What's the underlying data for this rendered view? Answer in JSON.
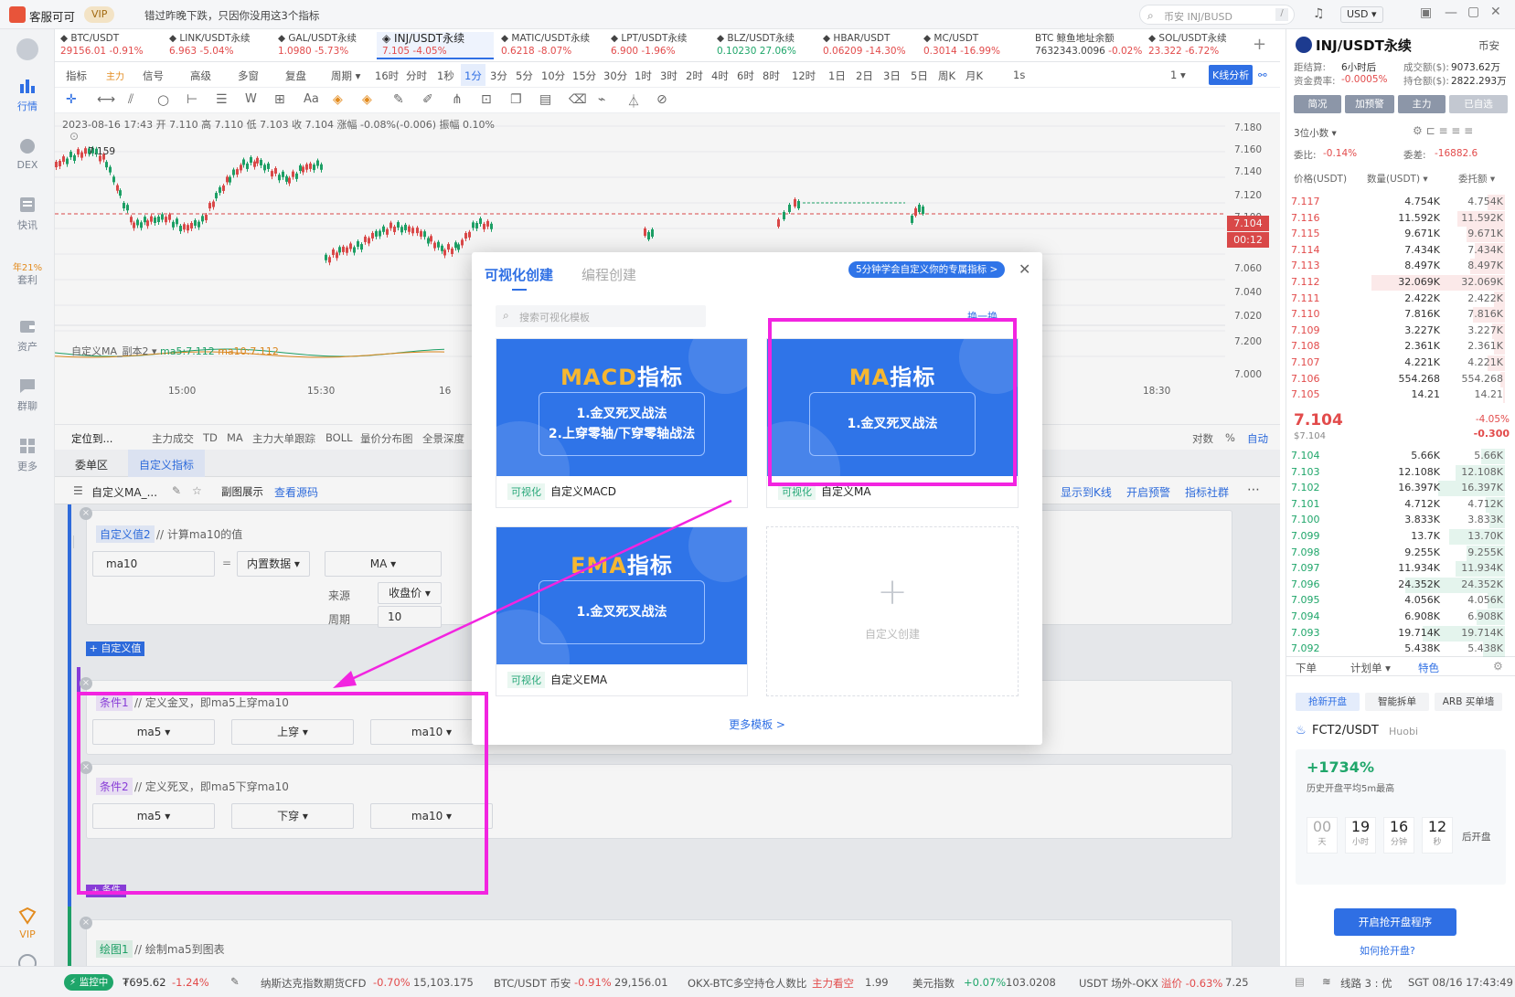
{
  "topbar": {
    "customer_service": "客服可可",
    "vip": "VIP",
    "notice": "错过昨晚下跌，只因你没用这3个指标",
    "search_placeholder": "币安 INJ/BUSD",
    "shortcut": "/",
    "currency": "USD ▾"
  },
  "left_nav": [
    {
      "label": "行情",
      "icon": "market-chart-icon"
    },
    {
      "label": "DEX",
      "icon": "dex-icon"
    },
    {
      "label": "快讯",
      "icon": "news-icon"
    },
    {
      "label": "年21%",
      "icon": ""
    },
    {
      "label": "套利",
      "icon": ""
    },
    {
      "label": "资产",
      "icon": "wallet-icon"
    },
    {
      "label": "群聊",
      "icon": "chat-icon"
    },
    {
      "label": "更多",
      "icon": "grid-icon"
    },
    {
      "label": "VIP",
      "icon": "vip-icon"
    }
  ],
  "tickers": [
    {
      "name": "BTC/USDT",
      "price": "29156.01",
      "change": "-0.91%"
    },
    {
      "name": "LINK/USDT永续",
      "price": "6.963",
      "change": "-5.04%"
    },
    {
      "name": "GAL/USDT永续",
      "price": "1.0980",
      "change": "-5.73%"
    },
    {
      "name": "INJ/USDT永续",
      "price": "7.105",
      "change": "-4.05%"
    },
    {
      "name": "MATIC/USDT永续",
      "price": "0.6218",
      "change": "-8.07%"
    },
    {
      "name": "LPT/USDT永续",
      "price": "6.900",
      "change": "-1.96%"
    },
    {
      "name": "BLZ/USDT永续",
      "price": "0.10230",
      "change": "27.06%"
    },
    {
      "name": "HBAR/USDT",
      "price": "0.06209",
      "change": "-14.30%"
    },
    {
      "name": "MC/USDT",
      "price": "0.3014",
      "change": "-16.99%"
    },
    {
      "name": "BTC 鲸鱼地址余额",
      "price": "7632343.0096",
      "change": "-0.02%"
    },
    {
      "name": "SOL/USDT永续",
      "price": "23.322",
      "change": "-6.72%"
    }
  ],
  "timeframes": [
    "指标",
    "主力",
    "信号",
    "高级",
    "多窗",
    "复盘",
    "周期 ▾",
    "16时",
    "分时",
    "1秒",
    "1分",
    "3分",
    "5分",
    "10分",
    "15分",
    "30分",
    "1时",
    "3时",
    "2时",
    "4时",
    "6时",
    "8时",
    "12时",
    "1日",
    "2日",
    "3日",
    "5日",
    "周K",
    "月K",
    "1s",
    "1 ▾",
    "K线分析"
  ],
  "chart": {
    "info": "2023-08-16 17:43  开 7.110  高 7.110  低 7.103  收 7.104  涨幅 -0.08%(-0.006)  振幅 0.10%",
    "high_label": "7.159",
    "price_axis": [
      "7.180",
      "7.160",
      "7.140",
      "7.120",
      "7.100",
      "7.080",
      "7.060",
      "7.040",
      "7.020",
      "7.200",
      "7.000"
    ],
    "current_price": "7.104",
    "countdown": "00:12",
    "time_axis": [
      "15:00",
      "15:30",
      "16",
      "18:00",
      "18:30"
    ],
    "sub_legend": "自定义MA_副本2 ▾",
    "ma5": "ma5:7.112",
    "ma10": "ma10:7.112"
  },
  "indicator_bar": {
    "locate": "定位到...",
    "items": [
      "主力成交",
      "TD",
      "MA",
      "主力大单跟踪",
      "BOLL",
      "量价分布图",
      "全景深度"
    ],
    "right": [
      "对数",
      "%",
      "自动"
    ]
  },
  "panel": {
    "tabs": [
      "委单区",
      "自定义指标"
    ],
    "toolbar_name": "自定义MA_...",
    "sub_show": "副图展示",
    "view_source": "查看源码",
    "right_actions": [
      "显示到K线",
      "开启预警",
      "指标社群"
    ],
    "value2": {
      "tag": "自定义值2",
      "comment": "// 计算ma10的值",
      "name": "ma10",
      "eq": "=",
      "source_type": "内置数据 ▾",
      "func": "MA ▾",
      "src_label": "来源",
      "src_val": "收盘价 ▾",
      "period_label": "周期",
      "period_val": "10"
    },
    "add_value": "+ 自定义值",
    "cond1": {
      "tag": "条件1",
      "comment": "// 定义金叉，即ma5上穿ma10",
      "a": "ma5 ▾",
      "op": "上穿 ▾",
      "b": "ma10 ▾"
    },
    "cond2": {
      "tag": "条件2",
      "comment": "// 定义死叉，即ma5下穿ma10",
      "a": "ma5 ▾",
      "op": "下穿 ▾",
      "b": "ma10 ▾"
    },
    "add_cond": "+ 条件",
    "plot1": {
      "tag": "绘图1",
      "comment": "// 绘制ma5到图表"
    }
  },
  "modal": {
    "tab_visual": "可视化创建",
    "tab_code": "编程创建",
    "promo": "5分钟学会自定义你的专属指标 >",
    "search_placeholder": "搜索可视化模板",
    "swap": "换一换",
    "templates": [
      {
        "title_a": "MACD",
        "title_b": "指标",
        "lines": [
          "1.金叉死叉战法",
          "2.上穿零轴/下穿零轴战法"
        ],
        "tag": "可视化",
        "name": "自定义MACD"
      },
      {
        "title_a": "MA",
        "title_b": "指标",
        "lines": [
          "1.金叉死叉战法"
        ],
        "tag": "可视化",
        "name": "自定义MA"
      },
      {
        "title_a": "EMA",
        "title_b": "指标",
        "lines": [
          "1.金叉死叉战法"
        ],
        "tag": "可视化",
        "name": "自定义EMA"
      }
    ],
    "custom_create": "自定义创建",
    "more": "更多模板 >"
  },
  "right_panel": {
    "pair": "INJ/USDT永续",
    "exchange": "币安",
    "funding_label": "距结算:",
    "funding_time": "6小时后",
    "rate_label": "资金费率:",
    "rate": "-0.0005%",
    "vol_label": "成交额($):",
    "vol": "9073.62万",
    "oi_label": "持仓额($):",
    "oi": "2822.293万",
    "buttons": [
      "简况",
      "加预警",
      "主力",
      "已自选"
    ],
    "decimals": "3位小数 ▾",
    "ratio_label": "委比:",
    "ratio": "-0.14%",
    "diff_label": "委差:",
    "diff": "-16882.6",
    "cols": [
      "价格(USDT)",
      "数量(USDT) ▾",
      "委托额 ▾"
    ],
    "asks": [
      {
        "p": "7.117",
        "q": "4.754K",
        "t": "4.754K",
        "w": 0.08
      },
      {
        "p": "7.116",
        "q": "11.592K",
        "t": "11.592K",
        "w": 0.22
      },
      {
        "p": "7.115",
        "q": "9.671K",
        "t": "9.671K",
        "w": 0.18
      },
      {
        "p": "7.114",
        "q": "7.434K",
        "t": "7.434K",
        "w": 0.14
      },
      {
        "p": "7.113",
        "q": "8.497K",
        "t": "8.497K",
        "w": 0.16
      },
      {
        "p": "7.112",
        "q": "32.069K",
        "t": "32.069K",
        "w": 0.62
      },
      {
        "p": "7.111",
        "q": "2.422K",
        "t": "2.422K",
        "w": 0.05
      },
      {
        "p": "7.110",
        "q": "7.816K",
        "t": "7.816K",
        "w": 0.15
      },
      {
        "p": "7.109",
        "q": "3.227K",
        "t": "3.227K",
        "w": 0.06
      },
      {
        "p": "7.108",
        "q": "2.361K",
        "t": "2.361K",
        "w": 0.05
      },
      {
        "p": "7.107",
        "q": "4.221K",
        "t": "4.221K",
        "w": 0.08
      },
      {
        "p": "7.106",
        "q": "554.268",
        "t": "554.268",
        "w": 0.02
      },
      {
        "p": "7.105",
        "q": "14.21",
        "t": "14.21",
        "w": 0.01
      }
    ],
    "last_price": "7.104",
    "last_usd": "$7.104",
    "last_change": "-4.05%",
    "last_diff": "-0.300",
    "bids": [
      {
        "p": "7.104",
        "q": "5.66K",
        "t": "5.66K",
        "w": 0.11
      },
      {
        "p": "7.103",
        "q": "12.108K",
        "t": "12.108K",
        "w": 0.23
      },
      {
        "p": "7.102",
        "q": "16.397K",
        "t": "16.397K",
        "w": 0.31
      },
      {
        "p": "7.101",
        "q": "4.712K",
        "t": "4.712K",
        "w": 0.09
      },
      {
        "p": "7.100",
        "q": "3.833K",
        "t": "3.833K",
        "w": 0.07
      },
      {
        "p": "7.099",
        "q": "13.7K",
        "t": "13.70K",
        "w": 0.26
      },
      {
        "p": "7.098",
        "q": "9.255K",
        "t": "9.255K",
        "w": 0.18
      },
      {
        "p": "7.097",
        "q": "11.934K",
        "t": "11.934K",
        "w": 0.23
      },
      {
        "p": "7.096",
        "q": "24.352K",
        "t": "24.352K",
        "w": 0.46
      },
      {
        "p": "7.095",
        "q": "4.056K",
        "t": "4.056K",
        "w": 0.08
      },
      {
        "p": "7.094",
        "q": "6.908K",
        "t": "6.908K",
        "w": 0.13
      },
      {
        "p": "7.093",
        "q": "19.714K",
        "t": "19.714K",
        "w": 0.38
      },
      {
        "p": "7.092",
        "q": "5.438K",
        "t": "5.438K",
        "w": 0.1
      }
    ],
    "order_tabs": [
      "下单",
      "计划单 ▾",
      "特色"
    ],
    "feature_btns": [
      "抢新开盘",
      "智能拆单",
      "ARB 买单墙"
    ],
    "promo_pair": "FCT2/USDT",
    "promo_ex": "Huobi",
    "promo_pct": "+1734%",
    "promo_desc": "历史开盘平均5m最高",
    "countdown": [
      {
        "v": "00",
        "u": "天"
      },
      {
        "v": "19",
        "u": "小时"
      },
      {
        "v": "16",
        "u": "分钟"
      },
      {
        "v": "12",
        "u": "秒"
      }
    ],
    "after_open": "后开盘",
    "start_btn": "开启抢开盘程序",
    "how": "如何抢开盘?"
  },
  "bottom": {
    "monitor": "监控中",
    "asset": "₮695.62",
    "asset_change": "-1.24%",
    "items": [
      {
        "name": "纳斯达克指数期货CFD",
        "chg": "-0.70%",
        "val": "15,103.175"
      },
      {
        "name": "BTC/USDT 币安",
        "chg": "-0.91%",
        "val": "29,156.01"
      },
      {
        "name": "OKX-BTC多空持仓人数比",
        "chg": "主力看空",
        "val": "1.99"
      },
      {
        "name": "美元指数",
        "chg": "+0.07%",
        "val": "103.0208"
      },
      {
        "name": "USDT 场外-OKX",
        "chg": "溢价 -0.63%",
        "val": "7.25"
      }
    ],
    "line": "线路 3 : 优",
    "time": "SGT 08/16 17:43:49"
  },
  "colors": {
    "accent": "#2f6fe4",
    "down": "#e24b4b",
    "up": "#1fa66a",
    "highlight": "#f224e0"
  }
}
